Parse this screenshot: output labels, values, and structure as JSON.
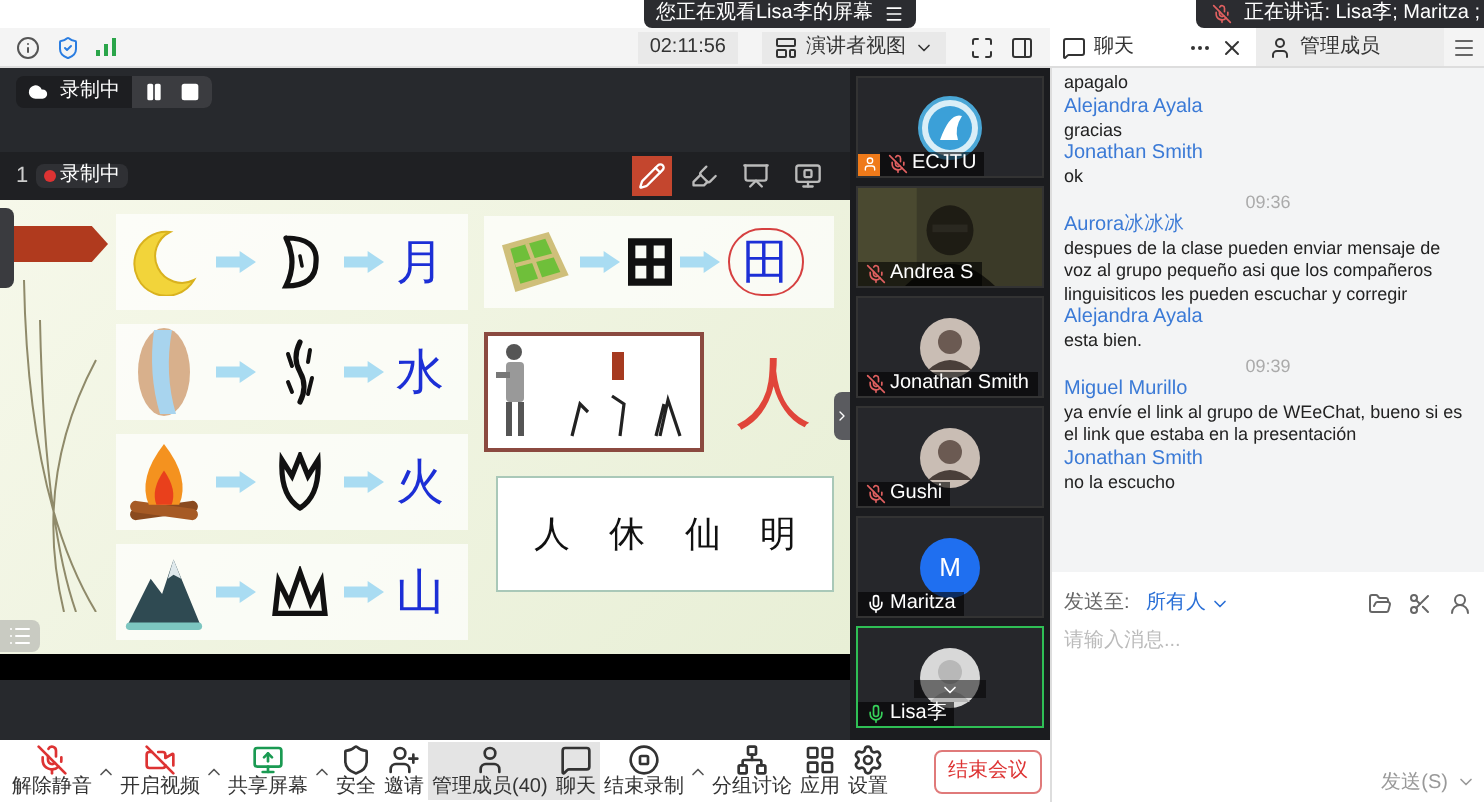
{
  "banner": {
    "text": "您正在观看Lisa李的屏幕"
  },
  "speaking": {
    "text": "正在讲话: Lisa李; Maritza ;"
  },
  "view_bar": {
    "time": "02:11:56",
    "view_mode": "演讲者视图"
  },
  "panel_tabs": [
    {
      "label": "聊天",
      "kind": "chat",
      "selected": true
    },
    {
      "label": "管理成员",
      "kind": "members",
      "selected": false
    }
  ],
  "recording": {
    "label": "录制中"
  },
  "share_toolbar": {
    "page": "1",
    "badge": "录制中",
    "tools": [
      {
        "kind": "pencil",
        "selected": true
      },
      {
        "kind": "highlighter",
        "selected": false
      },
      {
        "kind": "whiteboard",
        "selected": false
      },
      {
        "kind": "stop-annotate",
        "selected": false
      }
    ]
  },
  "slide": {
    "rows": [
      {
        "kind": "moon",
        "char": "月"
      },
      {
        "kind": "water",
        "char": "水"
      },
      {
        "kind": "fire",
        "char": "火"
      },
      {
        "kind": "mountain",
        "char": "山"
      }
    ],
    "field_char": "田",
    "person_char": "人",
    "compounds": [
      "人",
      "休",
      "仙",
      "明"
    ]
  },
  "videos": [
    {
      "name": "ECJTU",
      "kind": "logo",
      "muted": true,
      "speaking": false,
      "host": true
    },
    {
      "name": "Andrea S",
      "kind": "camera",
      "muted": true,
      "speaking": false,
      "host": false
    },
    {
      "name": "Jonathan Smith",
      "muted": true,
      "speaking": false,
      "host": false
    },
    {
      "name": "Gushi",
      "muted": true,
      "speaking": false,
      "host": false
    },
    {
      "name": "Maritza",
      "kind": "initial",
      "initial": "M",
      "muted": false,
      "speaking": false,
      "host": false
    },
    {
      "name": "Lisa李",
      "kind": "placeholder",
      "muted": false,
      "speaking": true,
      "host": false
    }
  ],
  "chat": {
    "messages": [
      {
        "kind": "message",
        "text": "apagalo"
      },
      {
        "kind": "sender",
        "text": "Alejandra Ayala"
      },
      {
        "kind": "message",
        "text": "gracias"
      },
      {
        "kind": "sender",
        "text": "Jonathan Smith"
      },
      {
        "kind": "message",
        "text": "ok"
      },
      {
        "kind": "time",
        "text": "09:36"
      },
      {
        "kind": "sender",
        "text": "Aurora冰冰冰"
      },
      {
        "kind": "message",
        "text": "despues de la clase pueden enviar mensaje de voz al grupo pequeño  asi que los compañeros linguisiticos les pueden escuchar y corregir"
      },
      {
        "kind": "sender",
        "text": "Alejandra Ayala"
      },
      {
        "kind": "message",
        "text": "esta bien."
      },
      {
        "kind": "time",
        "text": "09:39"
      },
      {
        "kind": "sender",
        "text": "Miguel Murillo"
      },
      {
        "kind": "message",
        "text": "ya envíe el link al grupo de WEeChat, bueno si es el link que estaba en la presentación"
      },
      {
        "kind": "sender",
        "text": "Jonathan Smith"
      },
      {
        "kind": "message",
        "text": "no la escucho"
      }
    ]
  },
  "compose": {
    "to_label": "发送至:",
    "recipient": "所有人",
    "placeholder": "请输入消息...",
    "send": "发送(S)"
  },
  "toolbar": [
    {
      "label": "解除静音",
      "kind": "mic-off",
      "caret": true,
      "selected": false
    },
    {
      "label": "开启视频",
      "kind": "video-off",
      "caret": true,
      "selected": false
    },
    {
      "label": "共享屏幕",
      "kind": "share",
      "caret": true,
      "selected": false
    },
    {
      "label": "安全",
      "kind": "shield",
      "caret": false,
      "selected": false
    },
    {
      "label": "邀请",
      "kind": "invite",
      "caret": false,
      "selected": false
    },
    {
      "label": "管理成员(40)",
      "kind": "members",
      "caret": false,
      "selected": true
    },
    {
      "label": "聊天",
      "kind": "chat",
      "caret": false,
      "selected": true
    },
    {
      "label": "结束录制",
      "kind": "stop-record",
      "caret": true,
      "selected": false
    },
    {
      "label": "分组讨论",
      "kind": "breakout",
      "caret": false,
      "selected": false
    },
    {
      "label": "应用",
      "kind": "apps",
      "caret": false,
      "selected": false
    },
    {
      "label": "设置",
      "kind": "settings",
      "caret": false,
      "selected": false
    }
  ],
  "end_button": "结束会议"
}
